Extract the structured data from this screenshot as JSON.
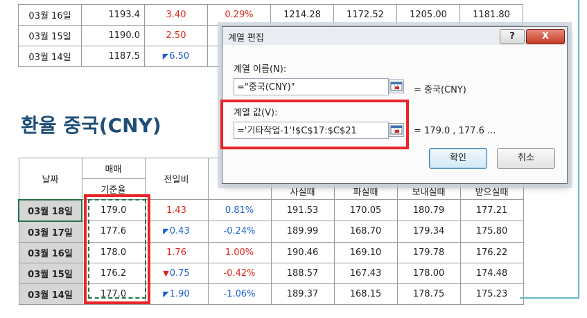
{
  "top_rows": [
    {
      "date": "03월 16일",
      "rate": "1193.4",
      "diff": "3.40",
      "diff_dir": "up",
      "pct": "0.29%",
      "buy": "1214.28",
      "sell": "1172.52",
      "send": "1205.00",
      "recv": "1181.80"
    },
    {
      "date": "03월 15일",
      "rate": "1190.0",
      "diff": "2.50",
      "diff_dir": "up",
      "pct": "",
      "buy": "",
      "sell": "",
      "send": "",
      "recv": ""
    },
    {
      "date": "03월 14일",
      "rate": "1187.5",
      "diff": "6.50",
      "diff_dir": "down",
      "pct": "",
      "buy": "",
      "sell": "",
      "send": "",
      "recv": ""
    }
  ],
  "section_title": "환율 중국(CNY)",
  "table_header": {
    "date": "날짜",
    "trade": "매매",
    "base_rate": "기준율",
    "prev": "전일비",
    "buy": "사실때",
    "sell": "파실때",
    "send": "보내실때",
    "recv": "받으실때"
  },
  "rows": [
    {
      "date": "03월 18일",
      "rate": "179.0",
      "diff": "1.43",
      "diff_dir": "up",
      "pct": "0.81%",
      "buy": "191.53",
      "sell": "170.05",
      "send": "180.79",
      "recv": "177.21"
    },
    {
      "date": "03월 17일",
      "rate": "177.6",
      "diff": "0.43",
      "diff_dir": "down",
      "pct": "-0.24%",
      "buy": "189.99",
      "sell": "168.70",
      "send": "179.34",
      "recv": "175.80"
    },
    {
      "date": "03월 16일",
      "rate": "178.0",
      "diff": "1.76",
      "diff_dir": "up",
      "pct": "1.00%",
      "buy": "190.46",
      "sell": "169.10",
      "send": "179.78",
      "recv": "176.22"
    },
    {
      "date": "03월 15일",
      "rate": "176.2",
      "diff": "0.75",
      "diff_dir": "down",
      "pct": "-0.42%",
      "buy": "188.57",
      "sell": "167.43",
      "send": "178.00",
      "recv": "174.48"
    },
    {
      "date": "03월 14일",
      "rate": "177.0",
      "diff": "1.90",
      "diff_dir": "down",
      "pct": "-1.06%",
      "buy": "189.37",
      "sell": "168.15",
      "send": "178.75",
      "recv": "175.23"
    }
  ],
  "dialog": {
    "title": "계열 편집",
    "help_label": "?",
    "close_label": "X",
    "series_name_label": "계열 이름(N):",
    "series_name_value": "=\"중국(CNY)\"",
    "series_name_preview": "= 중국(CNY)",
    "series_values_label": "계열 값(V):",
    "series_values_value": "='기타작업-1'!$C$17:$C$21",
    "series_values_preview": "= 179.0 , 177.6 ...",
    "ok_label": "확인",
    "cancel_label": "취소"
  },
  "colors": {
    "up": "#e0261d",
    "down": "#1a5fd0",
    "highlight": "#e8262a",
    "title": "#1f4e79"
  }
}
